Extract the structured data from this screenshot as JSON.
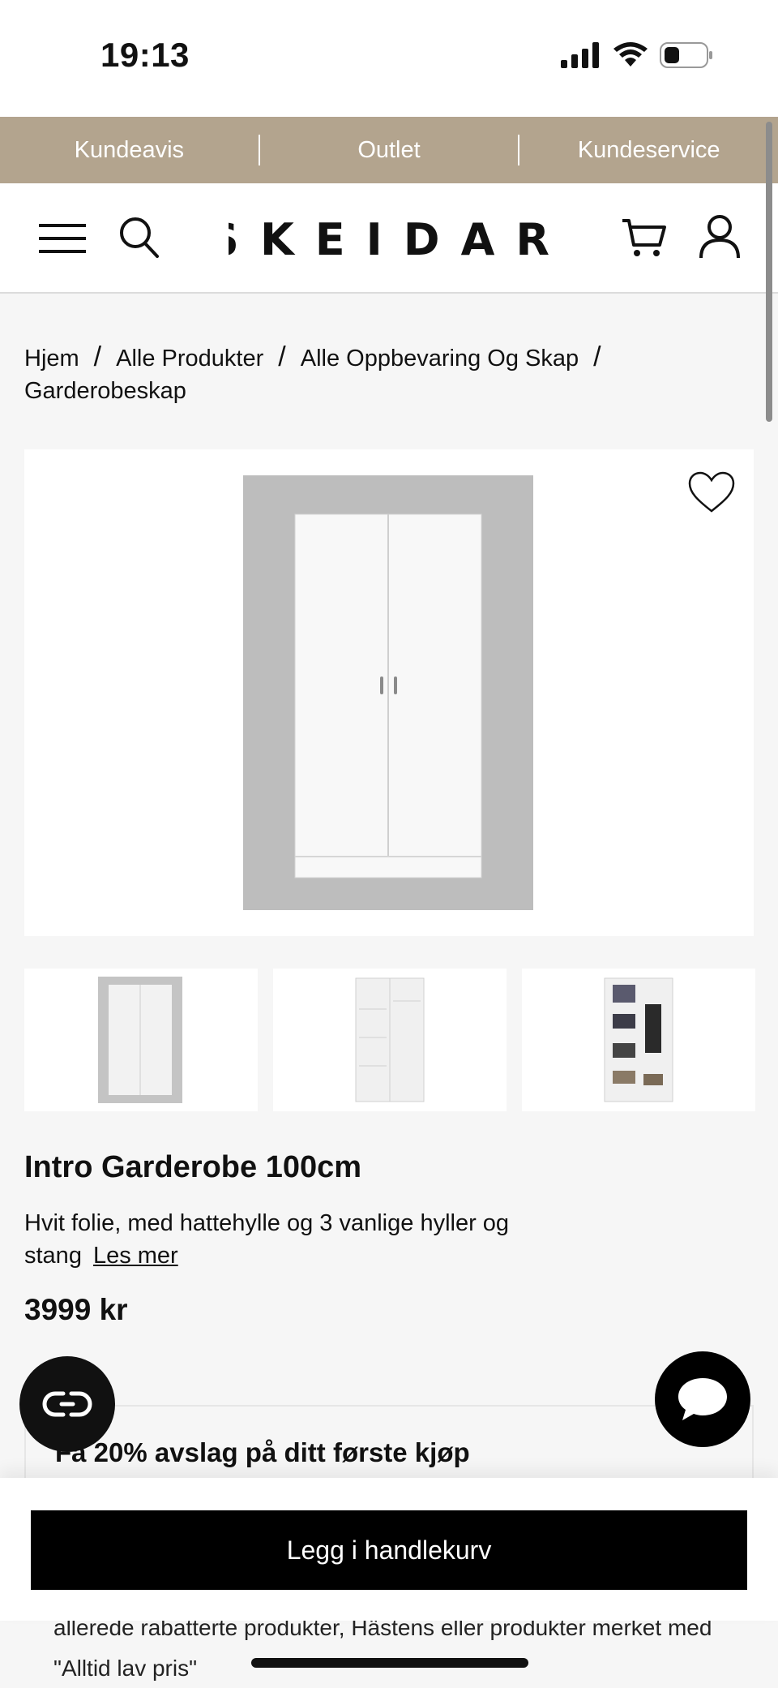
{
  "status_bar": {
    "time": "19:13"
  },
  "promo_bar": {
    "links": [
      "Kundeavis",
      "Outlet",
      "Kundeservice"
    ]
  },
  "header": {
    "logo_text": "SKEIDAR"
  },
  "breadcrumb": [
    "Hjem",
    "Alle Produkter",
    "Alle Oppbevaring Og Skap",
    "Garderobeskap"
  ],
  "product": {
    "title": "Intro Garderobe 100cm",
    "description": "Hvit folie, med hattehylle og 3 vanlige hyller og stang",
    "read_more": "Les mer",
    "price": "3999 kr"
  },
  "discount": {
    "title": "Få 20% avslag på ditt første kjøp",
    "note": "allerede rabatterte produkter, Hästens eller produkter merket med \"Alltid lav pris\""
  },
  "cart": {
    "button_label": "Legg i handlekurv"
  },
  "icons": [
    "menu-icon",
    "search-icon",
    "cart-icon",
    "account-icon",
    "heart-icon",
    "chat-icon",
    "link-icon"
  ],
  "colors": {
    "promo_bar": "#b3a48e",
    "button": "#000000",
    "background": "#f6f6f6"
  }
}
